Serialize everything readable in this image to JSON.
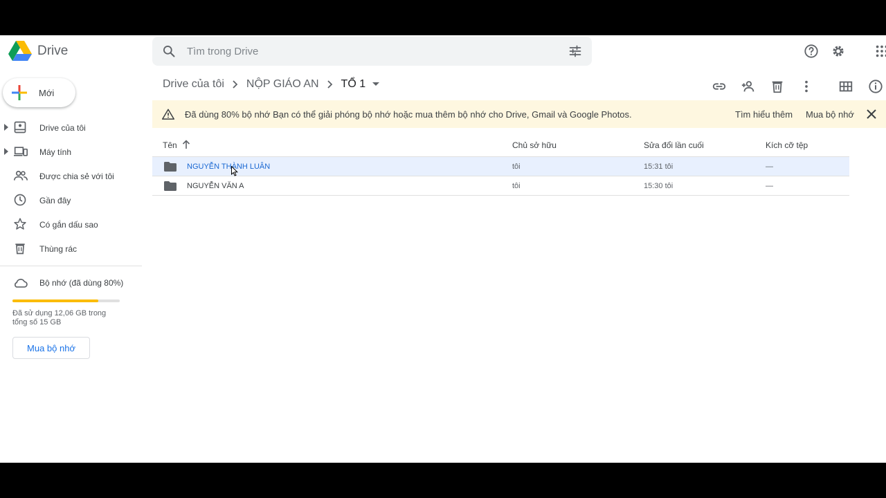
{
  "app": {
    "name": "Drive"
  },
  "search": {
    "placeholder": "Tìm trong Drive"
  },
  "sidebar": {
    "new_label": "Mới",
    "items": [
      {
        "label": "Drive của tôi",
        "icon": "my-drive-icon",
        "expandable": true
      },
      {
        "label": "Máy tính",
        "icon": "computers-icon",
        "expandable": true
      },
      {
        "label": "Được chia sẻ với tôi",
        "icon": "shared-icon",
        "expandable": false
      },
      {
        "label": "Gần đây",
        "icon": "recent-icon",
        "expandable": false
      },
      {
        "label": "Có gắn dấu sao",
        "icon": "star-icon",
        "expandable": false
      },
      {
        "label": "Thùng rác",
        "icon": "trash-icon",
        "expandable": false
      }
    ],
    "storage": {
      "title": "Bộ nhớ (đã dùng 80%)",
      "used_fraction": 0.8,
      "used_text": "Đã sử dụng 12,06 GB trong tổng số 15 GB",
      "buy_label": "Mua bộ nhớ"
    }
  },
  "breadcrumb": [
    "Drive của tôi",
    "NỘP GIÁO AN",
    "TỔ 1"
  ],
  "banner": {
    "bold": "Đã dùng 80% bộ nhớ",
    "message": " Bạn có thể giải phóng bộ nhớ hoặc mua thêm bộ nhớ cho Drive, Gmail và Google Photos.",
    "learn_more": "Tìm hiểu thêm",
    "buy": "Mua bộ nhớ"
  },
  "table": {
    "headers": {
      "name": "Tên",
      "owner": "Chủ sở hữu",
      "modified": "Sửa đổi lần cuối",
      "size": "Kích cỡ tệp"
    },
    "rows": [
      {
        "name": "NGUYỄN THÀNH LUÂN",
        "owner": "tôi",
        "modified": "15:31  tôi",
        "size": "—",
        "selected": true
      },
      {
        "name": "NGUYỄN VĂN A",
        "owner": "tôi",
        "modified": "15:30  tôi",
        "size": "—",
        "selected": false
      }
    ]
  },
  "colors": {
    "accent": "#1a73e8",
    "storage_bar": "#fbbc04",
    "selected_row": "#e8f0fe",
    "banner": "#fef7e0"
  }
}
